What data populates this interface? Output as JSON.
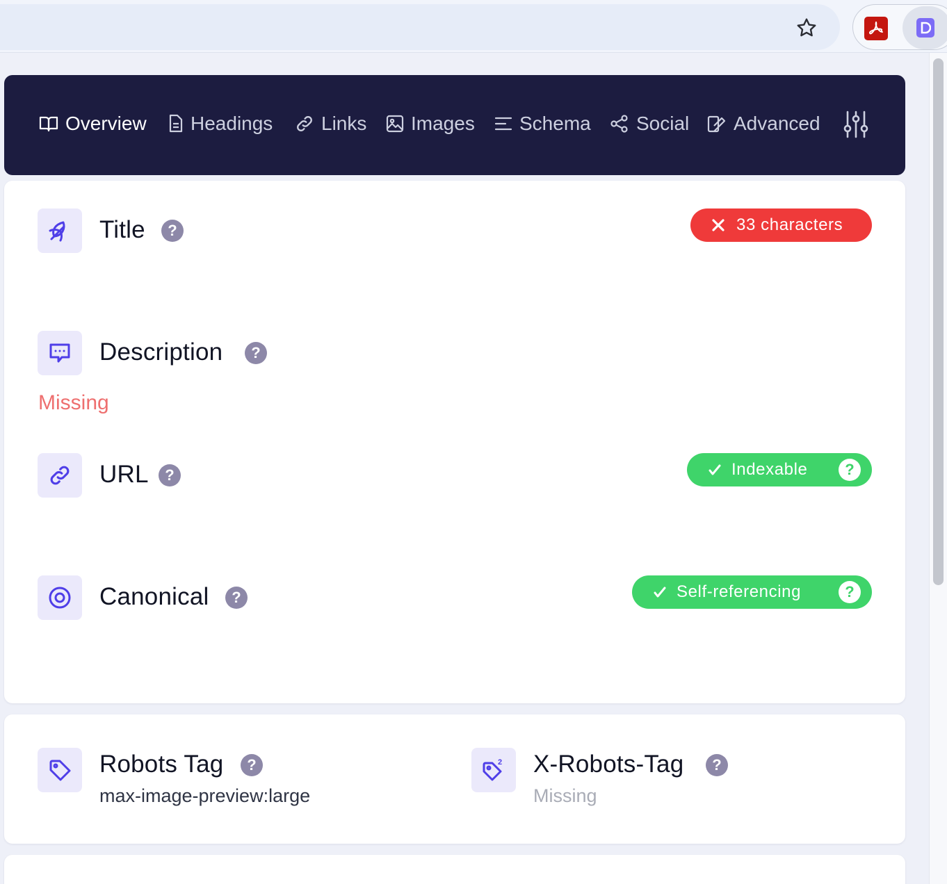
{
  "browser": {
    "bookmark_icon": "star-icon",
    "extensions": [
      "pdf-extension-icon",
      "detailed-extension-icon"
    ]
  },
  "nav": {
    "tabs": [
      {
        "label": "Overview",
        "icon": "book-icon",
        "active": true
      },
      {
        "label": "Headings",
        "icon": "document-icon",
        "active": false
      },
      {
        "label": "Links",
        "icon": "link-icon",
        "active": false
      },
      {
        "label": "Images",
        "icon": "image-icon",
        "active": false
      },
      {
        "label": "Schema",
        "icon": "lines-icon",
        "active": false
      },
      {
        "label": "Social",
        "icon": "share-icon",
        "active": false
      },
      {
        "label": "Advanced",
        "icon": "advanced-icon",
        "active": false
      }
    ],
    "settings_icon": "sliders-icon"
  },
  "overview": {
    "title": {
      "label": "Title",
      "help": "?",
      "badge": "33 characters",
      "badge_status": "error"
    },
    "description": {
      "label": "Description",
      "help": "?",
      "value": "Missing"
    },
    "url": {
      "label": "URL",
      "help": "?",
      "badge": "Indexable",
      "badge_help": "?",
      "badge_status": "ok"
    },
    "canonical": {
      "label": "Canonical",
      "help": "?",
      "badge": "Self-referencing",
      "badge_help": "?",
      "badge_status": "ok"
    }
  },
  "robots": {
    "robots_tag": {
      "label": "Robots Tag",
      "help": "?",
      "value": "max-image-preview:large"
    },
    "x_robots_tag": {
      "label": "X-Robots-Tag",
      "help": "?",
      "value": "Missing"
    }
  },
  "colors": {
    "nav_bg": "#1c1c40",
    "accent": "#4f3ee8",
    "error": "#ef3a3a",
    "success": "#3fd46a",
    "missing_text": "#ee6f6f"
  }
}
